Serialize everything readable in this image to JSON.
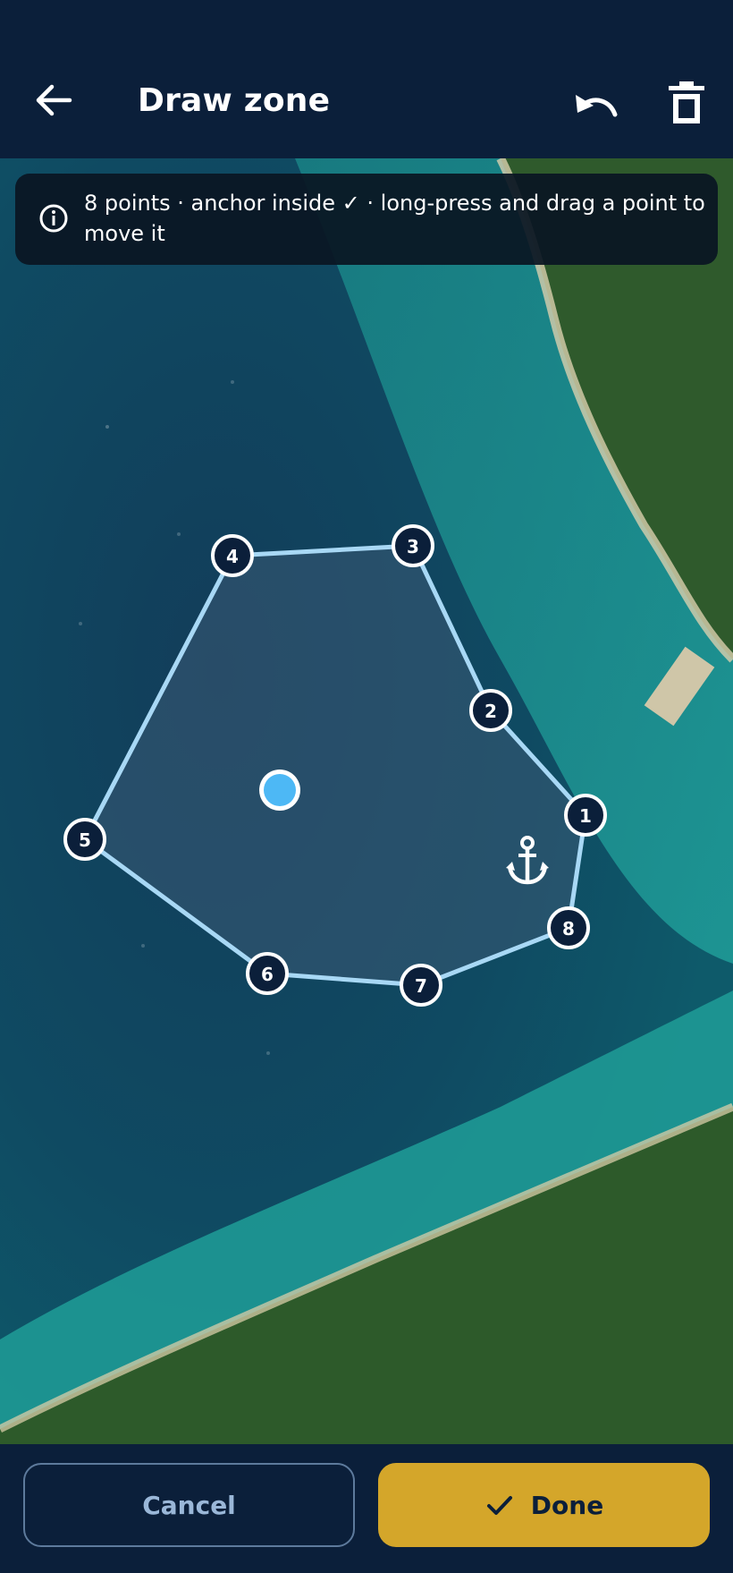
{
  "header": {
    "title": "Draw zone",
    "back_icon": "arrow-left-icon",
    "undo_icon": "undo-icon",
    "delete_icon": "trash-icon"
  },
  "info": {
    "icon": "info-icon",
    "text": "8 points · anchor inside ✓ · long-press and drag a point to move it"
  },
  "zone": {
    "point_count": 8,
    "anchor_inside": true,
    "points": [
      {
        "label": "1"
      },
      {
        "label": "2"
      },
      {
        "label": "3"
      },
      {
        "label": "4"
      },
      {
        "label": "5"
      },
      {
        "label": "6"
      },
      {
        "label": "7"
      },
      {
        "label": "8"
      }
    ],
    "anchor_icon": "anchor-icon",
    "location_icon": "current-location-dot-icon"
  },
  "footer": {
    "cancel_label": "Cancel",
    "done_label": "Done",
    "done_icon": "check-icon"
  },
  "colors": {
    "header_bg": "#0b1f3a",
    "accent": "#d4a62a",
    "zone_stroke": "#a8d8f5",
    "location_dot": "#4db8f5"
  }
}
